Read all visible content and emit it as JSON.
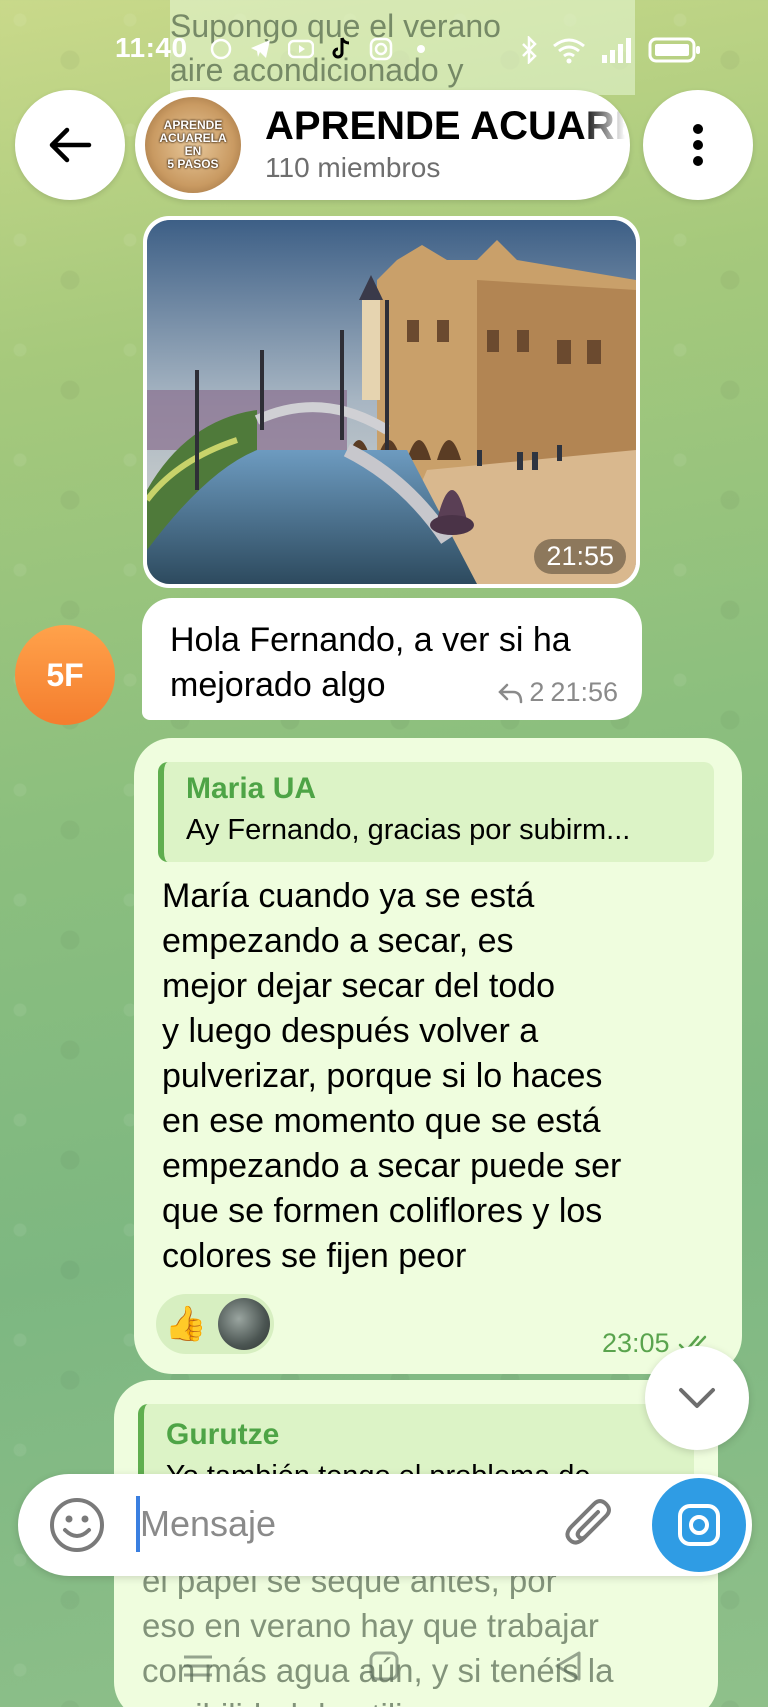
{
  "status_bar": {
    "time": "11:40",
    "icons": [
      "whatsapp-icon",
      "telegram-icon",
      "youtube-icon",
      "tiktok-icon",
      "instagram-icon",
      "dot-icon",
      "bluetooth-icon",
      "wifi-icon",
      "signal-icon",
      "battery-icon"
    ]
  },
  "background_messages": {
    "top": [
      "Supongo que el verano",
      "aire acondicionado y"
    ],
    "bottom": [
      "el papel se seque antes, por",
      "eso en verano hay que trabajar",
      "con más agua aún, y si tenéis la",
      "posibilidad de utilizar"
    ]
  },
  "header": {
    "title": "APRENDE ACUARELA",
    "subtitle": "110 miembros",
    "avatar_lines": [
      "APRENDE",
      "ACUARELA",
      "EN",
      "5 PASOS"
    ]
  },
  "messages": [
    {
      "type": "photo",
      "time": "21:55"
    },
    {
      "type": "incoming",
      "avatar_initials": "5F",
      "avatar_color": "#f7893a",
      "text_lines": [
        "Hola Fernando, a ver si ha",
        "mejorado algo"
      ],
      "reply_count": "2",
      "time": "21:56"
    },
    {
      "type": "outgoing",
      "reply_to": {
        "name": "Maria UA",
        "text": "Ay Fernando, gracias por subirm..."
      },
      "text_lines": [
        "María cuando ya se está",
        "empezando a secar, es",
        "mejor dejar secar del todo",
        "y luego después volver a",
        "pulverizar, porque si lo haces",
        "en ese momento que se está",
        "empezando a secar puede ser",
        "que se formen coliflores y los",
        "colores se fijen peor"
      ],
      "reactions": [
        "👍"
      ],
      "time": "23:05"
    },
    {
      "type": "outgoing",
      "reply_to": {
        "name": "Gurutze",
        "text": "Yo también tengo el problema de"
      }
    }
  ],
  "composer": {
    "placeholder": "Mensaje"
  },
  "colors": {
    "accent": "#2f9ce4",
    "outgoing_bubble": "#effdde",
    "quote_name": "#4ea446",
    "avatar_orange": "#f7893a"
  }
}
